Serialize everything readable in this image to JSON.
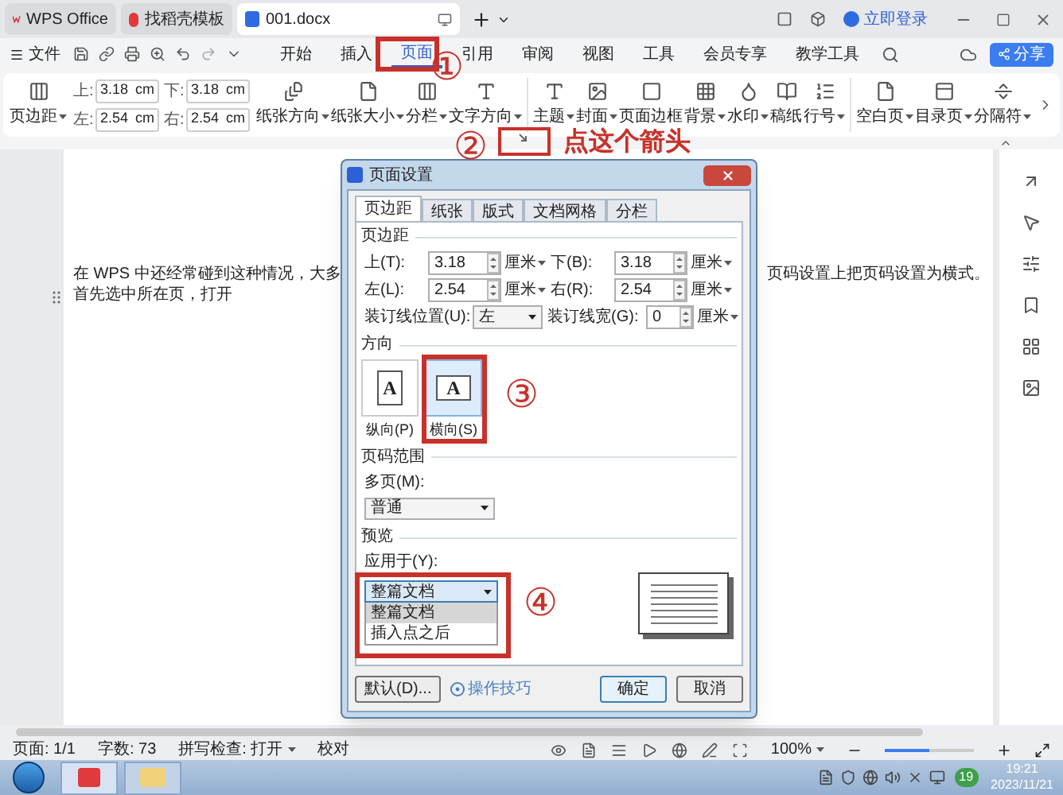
{
  "browser_tabs": [
    {
      "label": "WPS Office",
      "kind": "home",
      "selected": false
    },
    {
      "label": "找稻壳模板",
      "kind": "template",
      "selected": false
    },
    {
      "label": "001.docx",
      "kind": "doc",
      "selected": true
    }
  ],
  "account": {
    "label": "立即登录"
  },
  "menu": {
    "file": "文件",
    "tabs": [
      {
        "label": "开始",
        "selected": false
      },
      {
        "label": "插入",
        "selected": false
      },
      {
        "label": "页面",
        "selected": true
      },
      {
        "label": "引用",
        "selected": false
      },
      {
        "label": "审阅",
        "selected": false
      },
      {
        "label": "视图",
        "selected": false
      },
      {
        "label": "工具",
        "selected": false
      },
      {
        "label": "会员专享",
        "selected": false
      },
      {
        "label": "教学工具",
        "selected": false
      }
    ],
    "share": "分享"
  },
  "ribbon": {
    "margin_button": "页边距",
    "margins": [
      {
        "label": "上:",
        "value": "3.18",
        "unit": "cm"
      },
      {
        "label": "下:",
        "value": "3.18",
        "unit": "cm"
      },
      {
        "label": "左:",
        "value": "2.54",
        "unit": "cm"
      },
      {
        "label": "右:",
        "value": "2.54",
        "unit": "cm"
      }
    ],
    "buttons": [
      {
        "label": "纸张方向",
        "dropdown": true
      },
      {
        "label": "纸张大小",
        "dropdown": true
      },
      {
        "label": "分栏",
        "dropdown": true
      },
      {
        "label": "文字方向",
        "dropdown": true
      },
      {
        "label": "主题",
        "dropdown": true
      },
      {
        "label": "封面",
        "dropdown": true
      },
      {
        "label": "页面边框",
        "dropdown": false
      },
      {
        "label": "背景",
        "dropdown": true
      },
      {
        "label": "水印",
        "dropdown": true
      },
      {
        "label": "稿纸",
        "dropdown": false
      },
      {
        "label": "行号",
        "dropdown": true
      },
      {
        "label": "空白页",
        "dropdown": true
      },
      {
        "label": "目录页",
        "dropdown": true
      },
      {
        "label": "分隔符",
        "dropdown": true
      }
    ]
  },
  "document": {
    "line_1_left": "在 WPS 中还经常碰到这种情况，大多",
    "line_1_right": "页码设置上把页码设置为横式。",
    "line_2": "首先选中所在页，打开"
  },
  "dialog": {
    "title": "页面设置",
    "tabs": [
      {
        "label": "页边距",
        "selected": true
      },
      {
        "label": "纸张",
        "selected": false
      },
      {
        "label": "版式",
        "selected": false
      },
      {
        "label": "文档网格",
        "selected": false
      },
      {
        "label": "分栏",
        "selected": false
      }
    ],
    "margins_heading": "页边距",
    "margin_fields": [
      {
        "label": "上(T):",
        "value": "3.18",
        "unit": "厘米"
      },
      {
        "label": "下(B):",
        "value": "3.18",
        "unit": "厘米"
      },
      {
        "label": "左(L):",
        "value": "2.54",
        "unit": "厘米"
      },
      {
        "label": "右(R):",
        "value": "2.54",
        "unit": "厘米"
      }
    ],
    "gutter_position": {
      "label": "装订线位置(U):",
      "value": "左"
    },
    "gutter_width": {
      "label": "装订线宽(G):",
      "value": "0",
      "unit": "厘米"
    },
    "orientation_heading": "方向",
    "orientations": [
      {
        "label": "纵向(P)",
        "glyph": "A",
        "kind": "portrait",
        "selected": false
      },
      {
        "label": "横向(S)",
        "glyph": "A",
        "kind": "landscape",
        "selected": true
      }
    ],
    "page_range_heading": "页码范围",
    "multiple_pages": {
      "label": "多页(M):",
      "value": "普通"
    },
    "preview_heading": "预览",
    "apply_to": {
      "label": "应用于(Y):",
      "value": "整篇文档",
      "expanded": true,
      "options": [
        {
          "label": "整篇文档",
          "selected": true
        },
        {
          "label": "插入点之后",
          "selected": false
        }
      ]
    },
    "default_button": "默认(D)...",
    "tips_link": "操作技巧",
    "ok": "确定",
    "cancel": "取消"
  },
  "annotations": [
    {
      "kind": "circle",
      "label": "①"
    },
    {
      "kind": "circle",
      "label": "②"
    },
    {
      "kind": "note",
      "label": "点这个箭头"
    },
    {
      "kind": "circle",
      "label": "③"
    },
    {
      "kind": "circle",
      "label": "④"
    }
  ],
  "status_bar": {
    "page": "页面: 1/1",
    "words": "字数: 73",
    "spell": "拼写检查: 打开",
    "proofread": "校对",
    "zoom": "100%",
    "zoom_slider": {
      "level": 0.5
    }
  },
  "taskbar": {
    "badge": "19",
    "time": "19:21",
    "date": "2023/11/21"
  }
}
